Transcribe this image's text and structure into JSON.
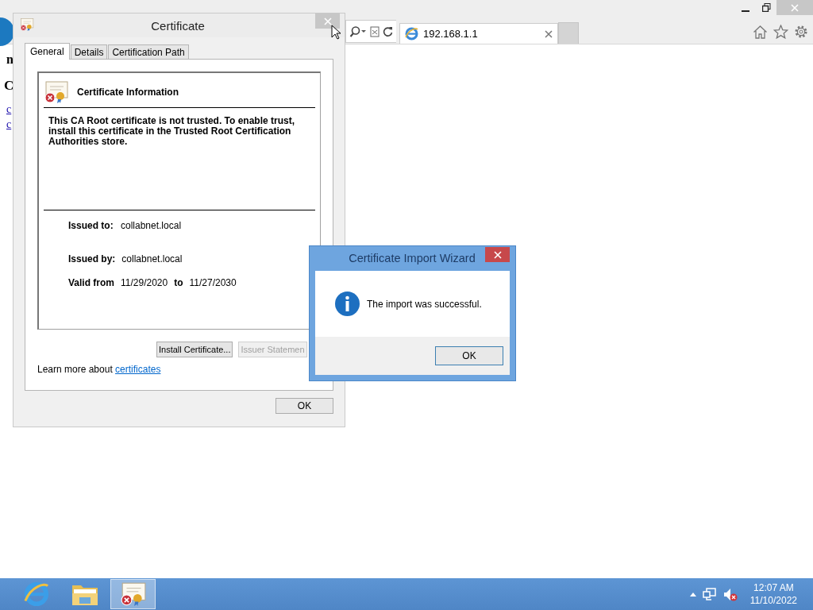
{
  "browser": {
    "tab": {
      "title": "192.168.1.1"
    },
    "page_fragments": [
      {
        "text": "n",
        "kind": "heading"
      },
      {
        "text": "C",
        "kind": "title"
      },
      {
        "text": "c",
        "kind": "link"
      },
      {
        "text": "c",
        "kind": "link"
      }
    ]
  },
  "certificate_dialog": {
    "title": "Certificate",
    "tabs": [
      {
        "label": "General",
        "selected": true
      },
      {
        "label": "Details",
        "selected": false
      },
      {
        "label": "Certification Path",
        "selected": false
      }
    ],
    "info_title": "Certificate Information",
    "message": "This CA Root certificate is not trusted. To enable trust, install this certificate in the Trusted Root Certification Authorities store.",
    "fields": [
      {
        "label": "Issued to:",
        "value": "collabnet.local"
      },
      {
        "label": "Issued by:",
        "value": "collabnet.local"
      }
    ],
    "validity": {
      "label": "Valid from",
      "from": "11/29/2020",
      "separator": "to",
      "until": "11/27/2030"
    },
    "buttons": [
      {
        "label": "Install Certificate...",
        "disabled": false
      },
      {
        "label": "Issuer Statemen",
        "disabled": true
      }
    ],
    "learn_more": {
      "text": "Learn more about",
      "link": "certificates"
    },
    "ok_button": "OK"
  },
  "wizard": {
    "title": "Certificate Import Wizard",
    "message": "The import was successful.",
    "ok_button": "OK"
  },
  "taskbar": {
    "apps": [
      {
        "kind": "browser",
        "active": false
      },
      {
        "kind": "folder",
        "active": false
      },
      {
        "kind": "certificate",
        "active": true
      }
    ],
    "time": "12:07 AM",
    "date": "11/10/2022"
  }
}
